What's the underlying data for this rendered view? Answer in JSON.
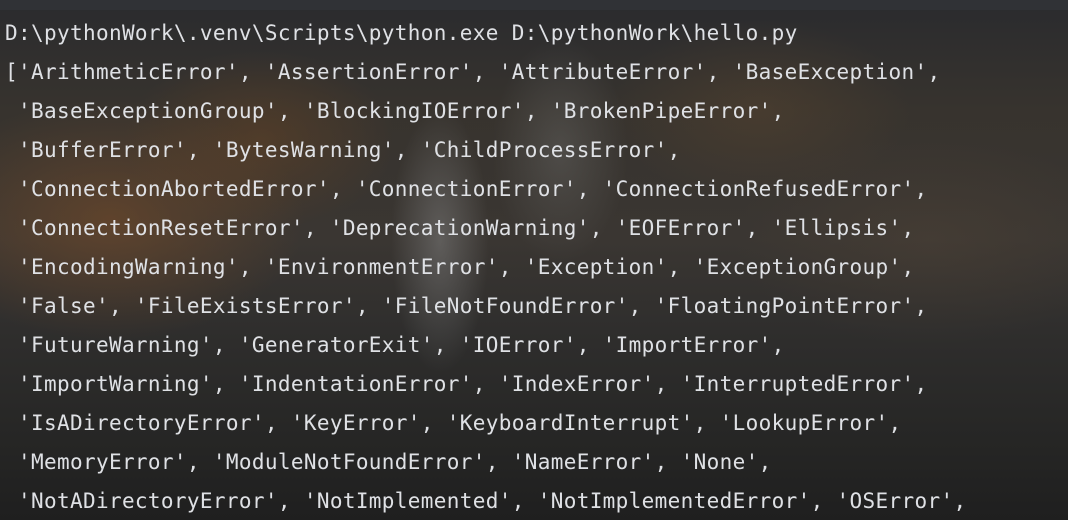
{
  "console": {
    "lines": [
      "D:\\pythonWork\\.venv\\Scripts\\python.exe D:\\pythonWork\\hello.py",
      "['ArithmeticError', 'AssertionError', 'AttributeError', 'BaseException',",
      " 'BaseExceptionGroup', 'BlockingIOError', 'BrokenPipeError',",
      " 'BufferError', 'BytesWarning', 'ChildProcessError',",
      " 'ConnectionAbortedError', 'ConnectionError', 'ConnectionRefusedError',",
      " 'ConnectionResetError', 'DeprecationWarning', 'EOFError', 'Ellipsis',",
      " 'EncodingWarning', 'EnvironmentError', 'Exception', 'ExceptionGroup',",
      " 'False', 'FileExistsError', 'FileNotFoundError', 'FloatingPointError',",
      " 'FutureWarning', 'GeneratorExit', 'IOError', 'ImportError',",
      " 'ImportWarning', 'IndentationError', 'IndexError', 'InterruptedError',",
      " 'IsADirectoryError', 'KeyError', 'KeyboardInterrupt', 'LookupError',",
      " 'MemoryError', 'ModuleNotFoundError', 'NameError', 'None',",
      " 'NotADirectoryError', 'NotImplemented', 'NotImplementedError', 'OSError',"
    ]
  }
}
